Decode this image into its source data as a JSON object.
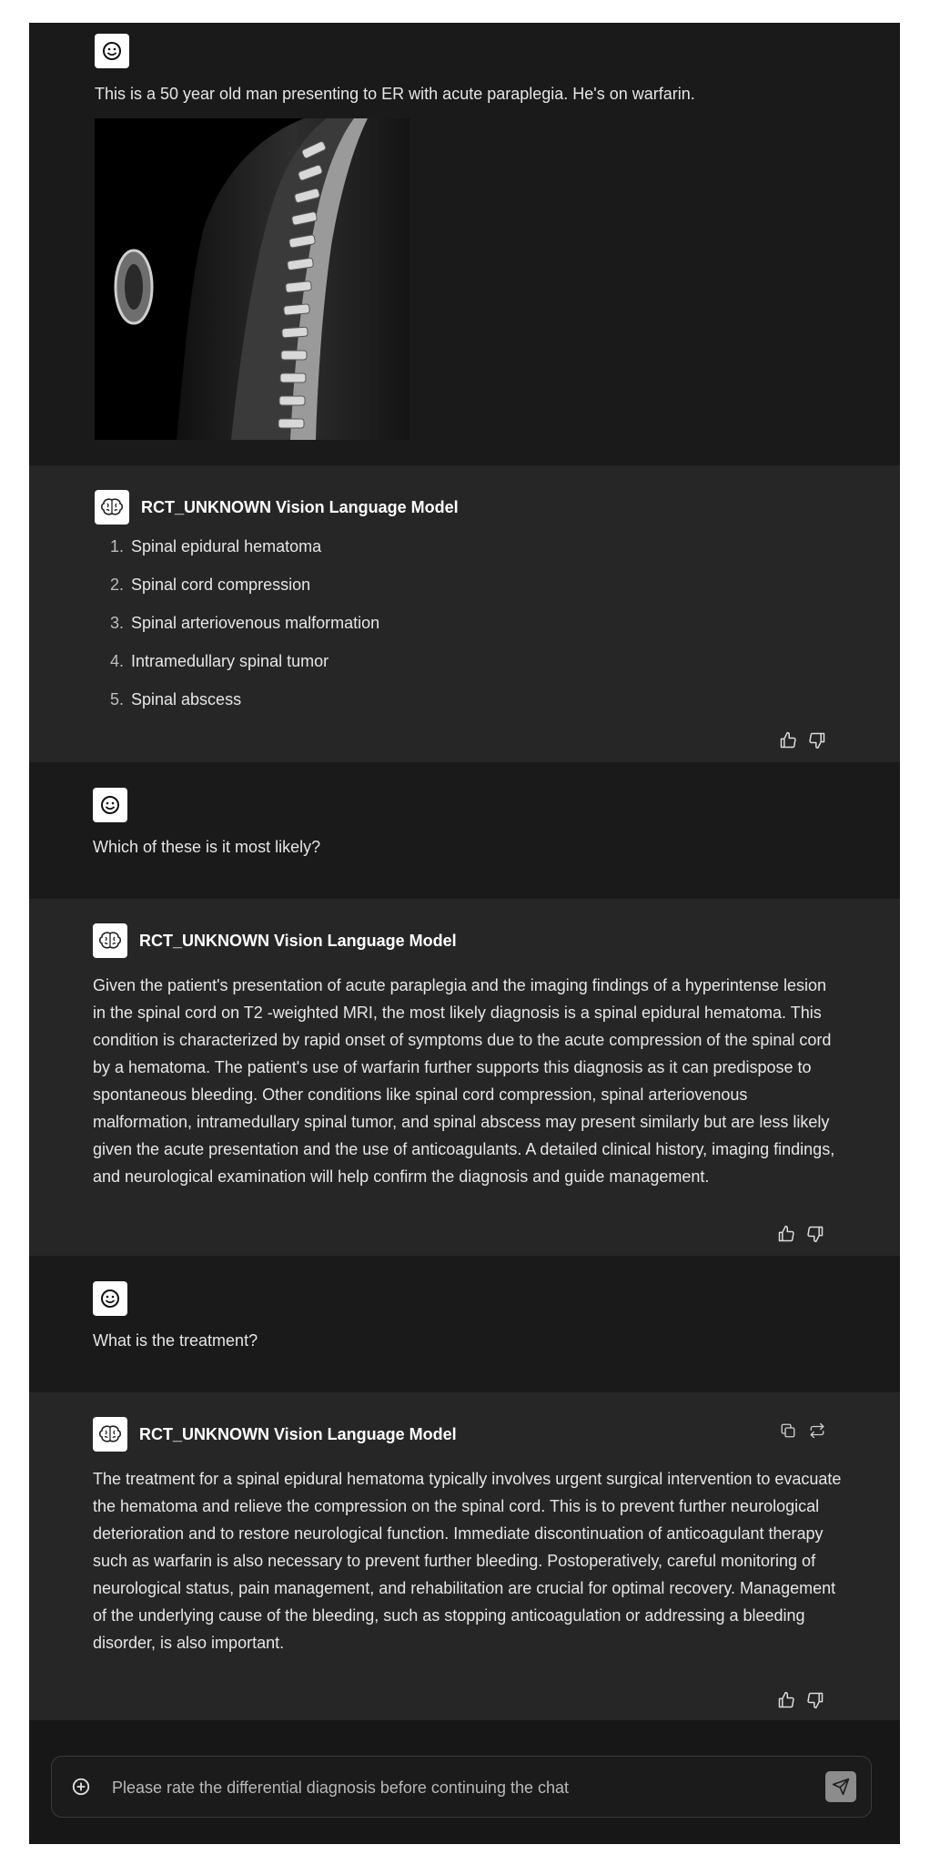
{
  "conversation": {
    "user_messages": [
      "This is a 50 year old man presenting to ER with acute paraplegia. He's on warfarin.",
      "Which of these is it most likely?",
      "What is the treatment?"
    ],
    "model_name": "RCT_UNKNOWN Vision Language Model",
    "response_1": {
      "items": [
        {
          "num": "1.",
          "text": "Spinal epidural hematoma"
        },
        {
          "num": "2.",
          "text": "Spinal cord compression"
        },
        {
          "num": "3.",
          "text": "Spinal arteriovenous malformation"
        },
        {
          "num": "4.",
          "text": "Intramedullary spinal tumor"
        },
        {
          "num": "5.",
          "text": "Spinal abscess"
        }
      ]
    },
    "response_2": "Given the patient's presentation of acute paraplegia and the imaging findings of a hyperintense lesion in the spinal cord on T2 -weighted MRI, the most likely diagnosis is a spinal epidural hematoma. This condition is characterized by rapid onset of symptoms due to the acute compression of the spinal cord by a hematoma. The patient's use of warfarin further supports this diagnosis as it can predispose to spontaneous bleeding. Other conditions like spinal cord compression, spinal arteriovenous malformation, intramedullary spinal tumor, and spinal abscess may present similarly but are less likely given the acute presentation and the use of anticoagulants. A detailed clinical history, imaging findings, and neurological examination will help confirm the diagnosis and guide management.",
    "response_3": "The treatment for a spinal epidural hematoma typically involves urgent surgical intervention to evacuate the hematoma and relieve the compression on the spinal cord. This is to prevent further neurological deterioration and to restore neurological function. Immediate discontinuation of anticoagulant therapy such as warfarin is also necessary to prevent further bleeding. Postoperatively, careful monitoring of neurological status, pain management, and rehabilitation are crucial for optimal recovery. Management of the underlying cause of the bleeding, such as stopping anticoagulation or addressing a bleeding disorder, is also important."
  },
  "composer": {
    "placeholder": "Please rate the differential diagnosis before continuing the chat"
  },
  "icons": {
    "user_avatar": "smiley-face-icon",
    "model_avatar": "brain-icon",
    "thumbs_up": "thumbs-up-icon",
    "thumbs_down": "thumbs-down-icon",
    "copy": "copy-icon",
    "regenerate": "regenerate-icon",
    "add": "plus-circle-icon",
    "send": "send-icon"
  }
}
